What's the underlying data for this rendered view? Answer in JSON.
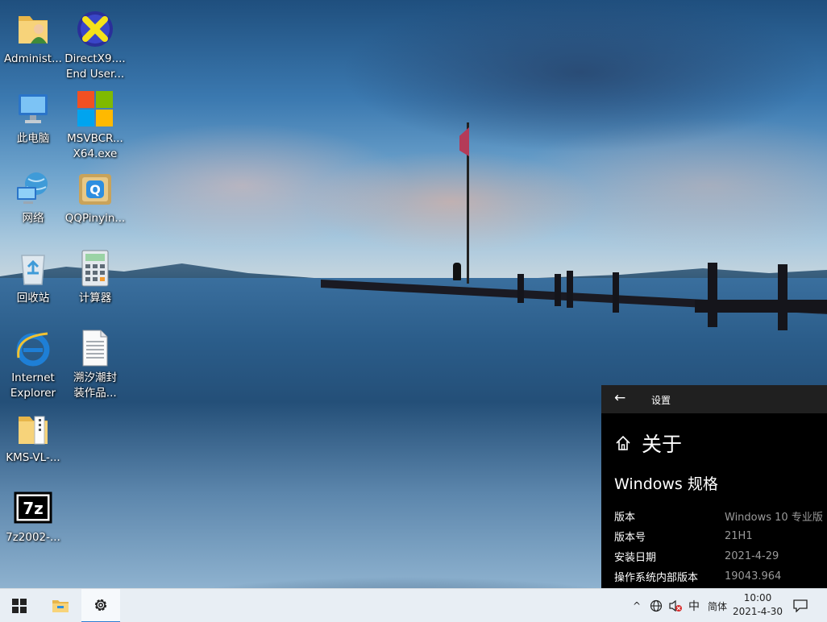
{
  "desktop": {
    "icons": [
      {
        "label": "Administ...",
        "icon": "user-folder-icon"
      },
      {
        "label": "DirectX9....\nEnd User...",
        "icon": "directx-icon"
      },
      {
        "label": "此电脑",
        "icon": "this-pc-icon"
      },
      {
        "label": "MSVBCR...\nX64.exe",
        "icon": "windows-logo-icon"
      },
      {
        "label": "网络",
        "icon": "network-icon"
      },
      {
        "label": "QQPinyin...",
        "icon": "qqpinyin-icon"
      },
      {
        "label": "回收站",
        "icon": "recycle-bin-icon"
      },
      {
        "label": "计算器",
        "icon": "calculator-icon"
      },
      {
        "label": "Internet\nExplorer",
        "icon": "internet-explorer-icon"
      },
      {
        "label": "溯汐潮封\n装作品...",
        "icon": "text-document-icon"
      },
      {
        "label": "KMS-VL-...",
        "icon": "zip-folder-icon"
      },
      {
        "label": "7z2002-...",
        "icon": "7zip-icon"
      }
    ]
  },
  "settings": {
    "window_title": "设置",
    "page_title": "关于",
    "section_title": "Windows 规格",
    "specs": [
      {
        "key": "版本",
        "value": "Windows 10 专业版"
      },
      {
        "key": "版本号",
        "value": "21H1"
      },
      {
        "key": "安装日期",
        "value": "2021-4-29"
      },
      {
        "key": "操作系统内部版本",
        "value": "19043.964"
      }
    ]
  },
  "taskbar": {
    "start_icon": "windows-start-icon",
    "pinned": [
      "file-explorer-icon",
      "settings-gear-icon"
    ],
    "tray": {
      "chevron": "^",
      "ime_mode": "中",
      "ime_style": "简体"
    },
    "clock": {
      "time": "10:00",
      "date": "2021-4-30"
    }
  },
  "colors": {
    "taskbar_bg": "#e8eef4",
    "settings_bg": "#000000",
    "settings_titlebar": "#202020",
    "accent": "#2f7fd3"
  }
}
